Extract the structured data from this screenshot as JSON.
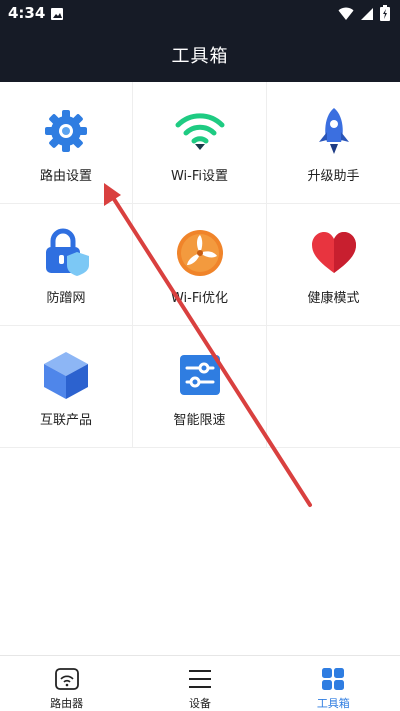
{
  "status_bar": {
    "time": "4:34"
  },
  "header": {
    "title": "工具箱"
  },
  "tools": [
    {
      "label": "路由设置",
      "icon": "gear-icon"
    },
    {
      "label": "Wi-Fi设置",
      "icon": "wifi-icon"
    },
    {
      "label": "升级助手",
      "icon": "rocket-icon"
    },
    {
      "label": "防蹭网",
      "icon": "lock-shield-icon"
    },
    {
      "label": "Wi-Fi优化",
      "icon": "fan-icon"
    },
    {
      "label": "健康模式",
      "icon": "heart-icon"
    },
    {
      "label": "互联产品",
      "icon": "cube-icon"
    },
    {
      "label": "智能限速",
      "icon": "sliders-icon"
    }
  ],
  "bottom_nav": [
    {
      "label": "路由器",
      "icon": "router-icon",
      "active": false
    },
    {
      "label": "设备",
      "icon": "menu-icon",
      "active": false
    },
    {
      "label": "工具箱",
      "icon": "grid-icon",
      "active": true
    }
  ],
  "colors": {
    "header_bg": "#161b26",
    "accent": "#2f7de1",
    "arrow": "#d9403f"
  }
}
